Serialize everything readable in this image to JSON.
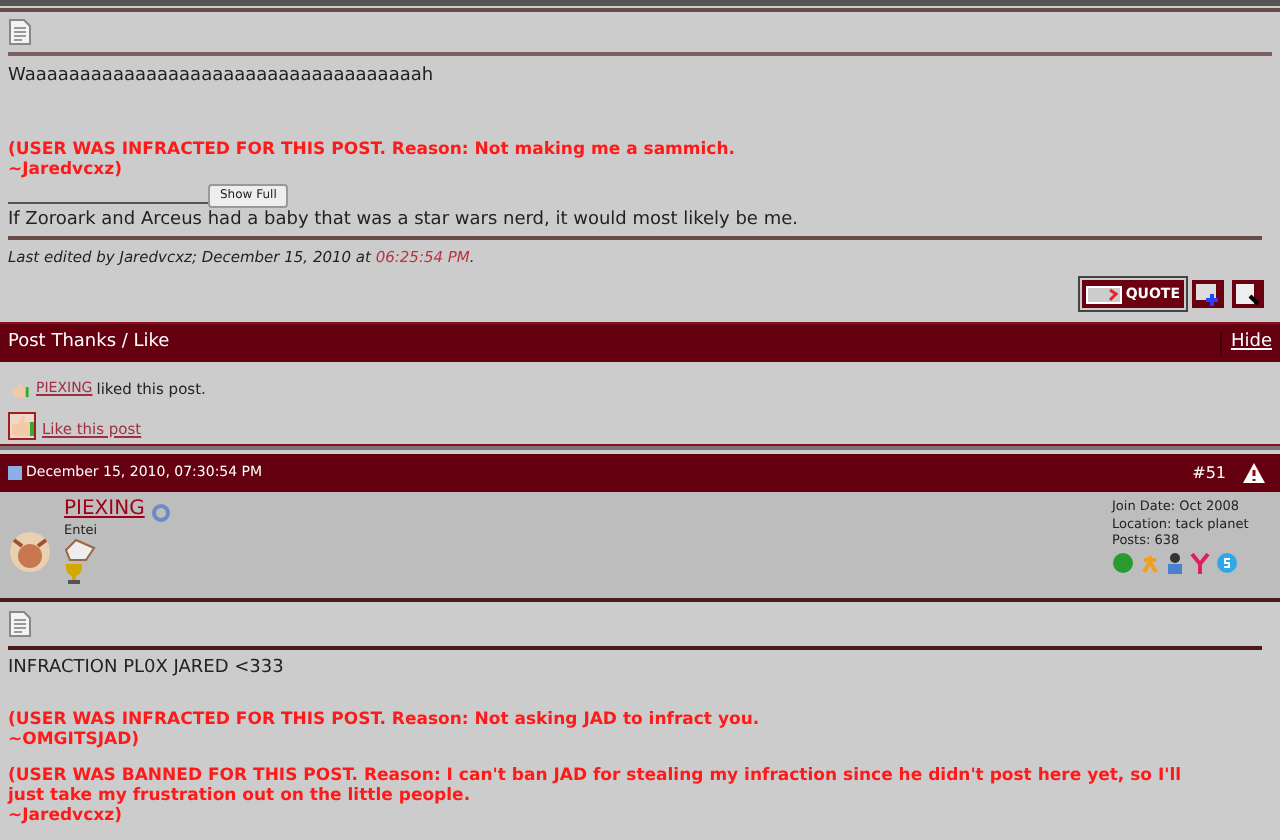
{
  "post_1": {
    "message": "Waaaaaaaaaaaaaaaaaaaaaaaaaaaaaaaaaaaah",
    "infractions": [
      "(USER WAS INFRACTED FOR THIS POST. Reason: Not making me a sammich.\n~Jaredvcxz)"
    ],
    "signature": {
      "button": "Show Full",
      "text": "If Zoroark and Arceus had a baby that was a star wars nerd, it would most likely be me."
    },
    "last_edited": {
      "text": "Last edited by Jaredvcxz; December 15, 2010 at ",
      "time": "06:25:54 PM",
      "end": "."
    },
    "quote_button": "QUOTE"
  },
  "thanks": {
    "title": "Post Thanks / Like",
    "hide": "Hide",
    "likers": [
      {
        "user": "PIEXING",
        "text": "liked this post."
      }
    ],
    "like_link": "Like this post"
  },
  "post_2": {
    "date": "December 15, 2010, 07:30:54 PM",
    "number": "#51",
    "user": {
      "name": "PIEXING",
      "title": "Entei",
      "details": [
        "Join Date: Oct 2008",
        "Location: tack planet",
        "Posts: 638"
      ]
    },
    "message": "INFRACTION PL0X JARED <333",
    "infractions": [
      "(USER WAS INFRACTED FOR THIS POST. Reason: Not asking JAD to infract you.\n~OMGITSJAD)",
      "(USER WAS BANNED FOR THIS POST. Reason: I can't ban JAD for stealing my infraction since he didn't post here yet, so I'll just take my frustration out on the little people.\n~Jaredvcxz)"
    ]
  }
}
